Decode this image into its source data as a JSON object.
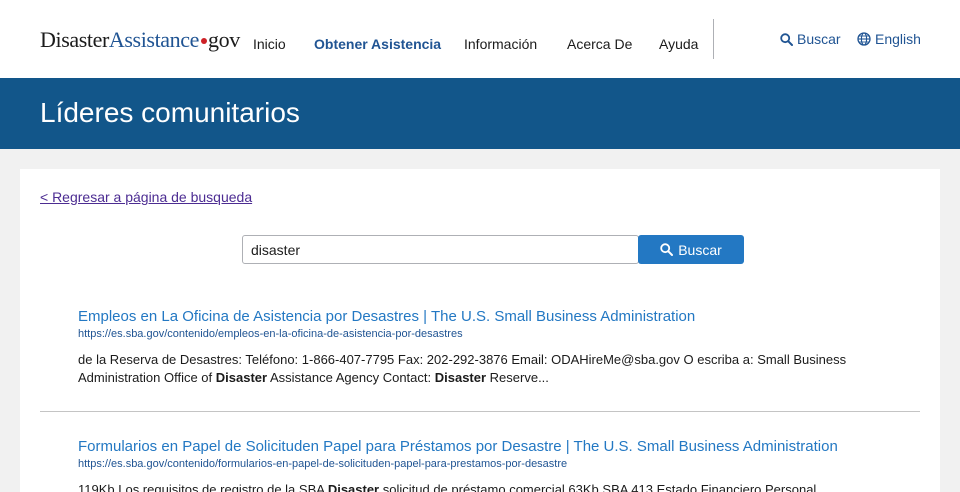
{
  "header": {
    "logo": {
      "part1": "Disaster",
      "part2": "Assistance",
      "part3": "gov"
    },
    "nav": [
      "Inicio",
      "Obtener Asistencia",
      "Información",
      "Acerca De",
      "Ayuda"
    ],
    "active_nav": "Obtener Asistencia",
    "search_label": "Buscar",
    "language_label": "English"
  },
  "banner": {
    "title": "Líderes comunitarios"
  },
  "content": {
    "back_link": "< Regresar a página de busqueda",
    "search": {
      "value": "disaster",
      "button_label": "Buscar"
    },
    "results": [
      {
        "title": "Empleos en La Oficina de Asistencia por Desastres | The U.S. Small Business Administration",
        "url": "https://es.sba.gov/contenido/empleos-en-la-oficina-de-asistencia-por-desastres",
        "snippet": [
          {
            "text": "de la Reserva de Desastres: Teléfono: 1-866-407-7795 Fax: 202-292-3876 Email: ODAHireMe@sba.gov O escriba a: Small Business Administration Office of ",
            "bold": false
          },
          {
            "text": "Disaster",
            "bold": true
          },
          {
            "text": " Assistance Agency Contact: ",
            "bold": false
          },
          {
            "text": "Disaster",
            "bold": true
          },
          {
            "text": " Reserve...",
            "bold": false
          }
        ]
      },
      {
        "title": "Formularios en Papel de Solicituden Papel para Préstamos por Desastre | The U.S. Small Business Administration",
        "url": "https://es.sba.gov/contenido/formularios-en-papel-de-solicituden-papel-para-prestamos-por-desastre",
        "snippet": [
          {
            "text": "119Kb Los requisitos de registro de la SBA ",
            "bold": false
          },
          {
            "text": "Disaster",
            "bold": true
          },
          {
            "text": " solicitud de préstamo comercial 63Kb SBA 413 Estado Financiero Personal",
            "bold": false
          }
        ]
      }
    ]
  },
  "colors": {
    "brand_blue": "#205493",
    "banner": "#12568a",
    "button": "#2378c3",
    "logo_dot": "#cd2026",
    "visited_link": "#4c2c92"
  },
  "icons": [
    "search-icon",
    "globe-icon"
  ]
}
